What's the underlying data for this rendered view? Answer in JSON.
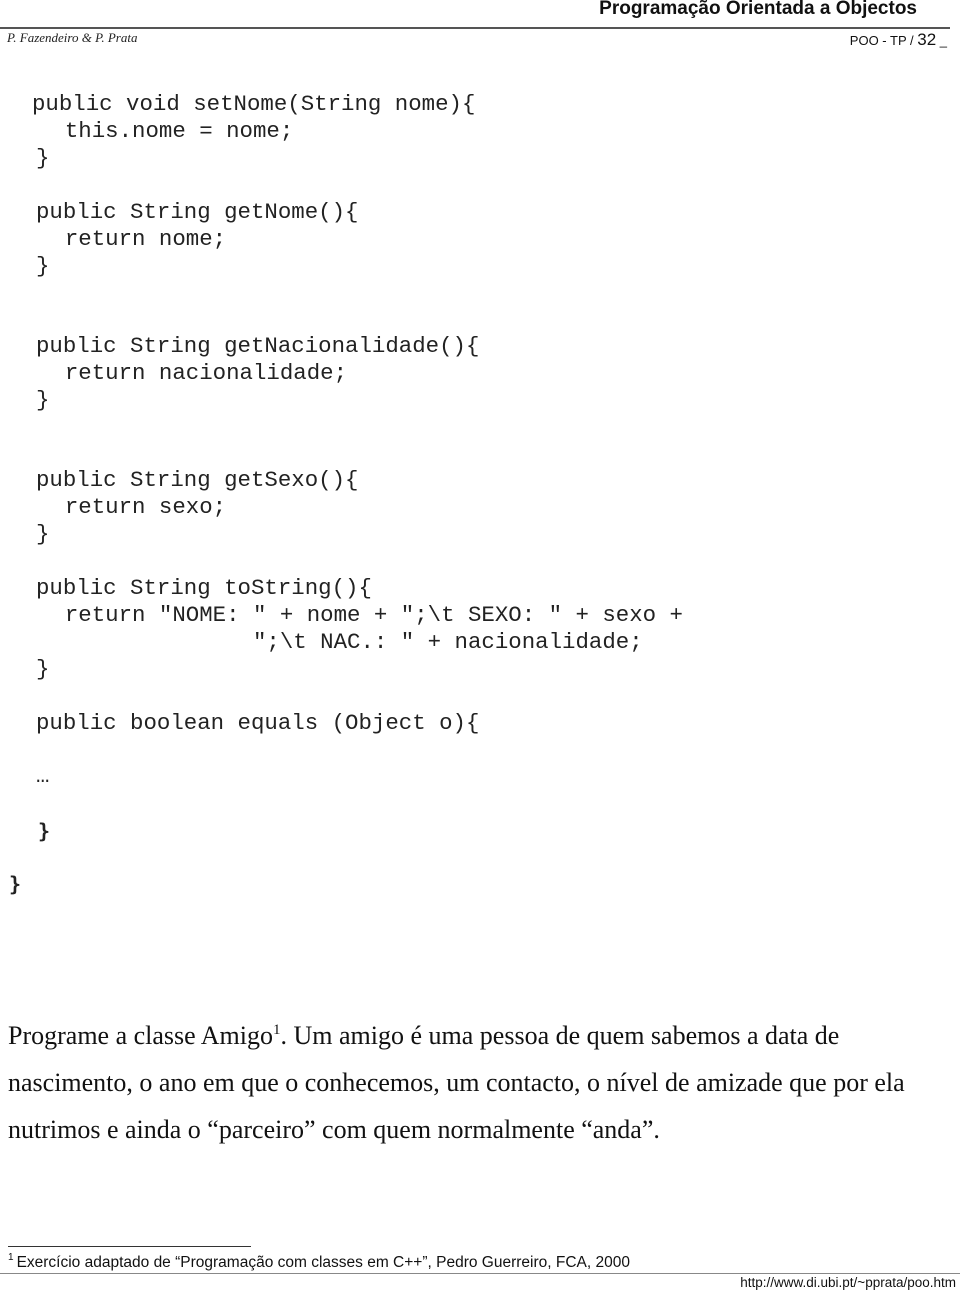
{
  "header": {
    "title": "Programação Orientada a Objectos",
    "authors": "P. Fazendeiro & P. Prata",
    "page_prefix": "POO - TP / ",
    "page_number": "32",
    "page_suffix": " _"
  },
  "code": {
    "lines": [
      "public void setNome(String nome){",
      "  this.nome = nome;",
      "}",
      "public String getNome(){",
      "  return nome;",
      "}",
      "public String getNacionalidade(){",
      "  return nacionalidade;",
      "}",
      "public String getSexo(){",
      "  return sexo;",
      "}",
      "public String toString(){",
      "  return \"NOME: \" + nome + \";\\t SEXO: \" + sexo +",
      "                \";\\t NAC.: \" + nacionalidade;",
      "}",
      "public boolean equals (Object o){",
      "…",
      "}",
      "}"
    ]
  },
  "exercise": {
    "text_before_note": "Programe a classe Amigo",
    "note_ref": "1",
    "text_after_note": ". Um amigo é uma pessoa de quem sabemos a data de nascimento, o ano em que o conhecemos, um contacto, o nível de amizade que por ela nutrimos e ainda o “parceiro” com quem normalmente “anda”."
  },
  "footnote": {
    "number": "1",
    "text": "Exercício adaptado de “Programação com classes em C++”, Pedro Guerreiro, FCA, 2000"
  },
  "footer": {
    "url": "http://www.di.ubi.pt/~pprata/poo.htm"
  }
}
